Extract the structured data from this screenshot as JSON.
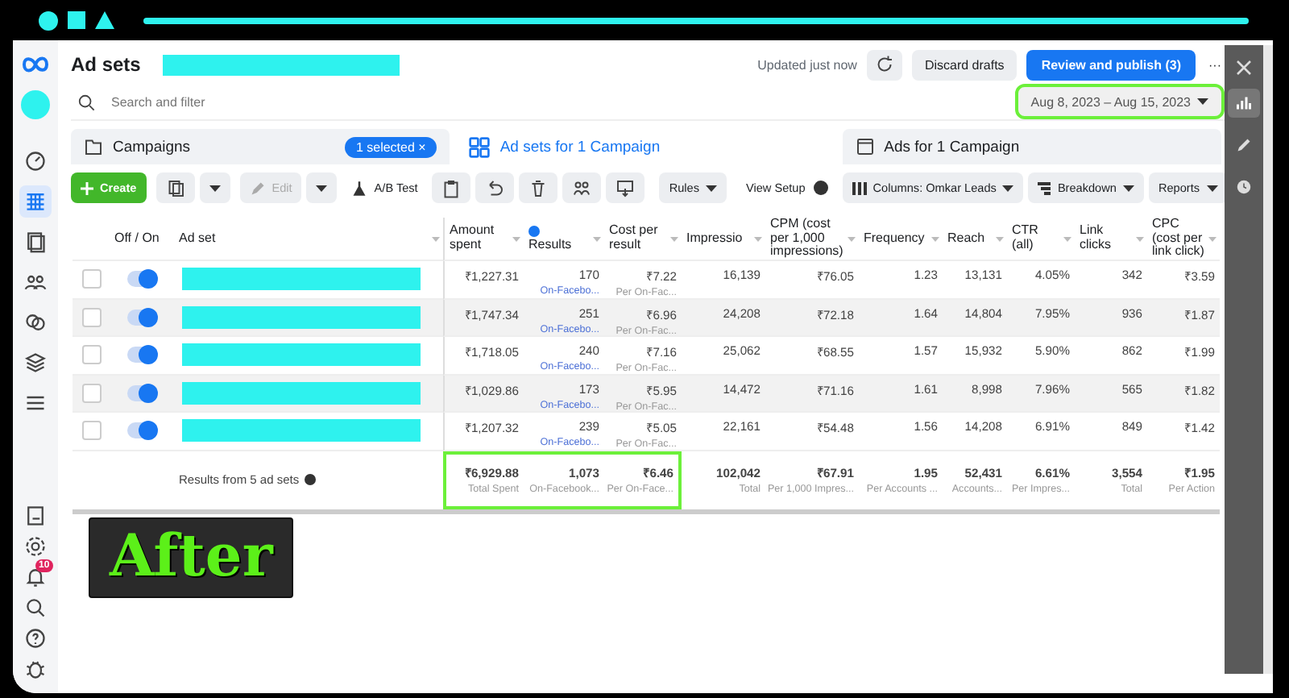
{
  "header": {
    "title": "Ad sets",
    "status": "Updated just now",
    "discard": "Discard drafts",
    "publish": "Review and publish (3)",
    "more": "···"
  },
  "search": {
    "placeholder": "Search and filter"
  },
  "date_range": {
    "value": "Aug 8, 2023 – Aug 15, 2023",
    "highlighted": true
  },
  "tabs": [
    {
      "label": "Campaigns",
      "selected": false,
      "badge": "1 selected",
      "badge_close": "×"
    },
    {
      "label": "Ad sets for 1 Campaign",
      "selected": true
    },
    {
      "label": "Ads for 1 Campaign",
      "selected": false
    }
  ],
  "toolbar": {
    "create": "Create",
    "edit": {
      "label": "Edit",
      "disabled": true
    },
    "ab_test": "A/B Test",
    "rules": "Rules",
    "view_setup": "View Setup",
    "columns": "Columns: Omkar Leads",
    "breakdown": "Breakdown",
    "reports": "Reports"
  },
  "table": {
    "toggle_column": "Off / On",
    "name_column": "Ad set",
    "columns": [
      "Amount spent",
      "Results",
      "Cost per result",
      "Impressio",
      "CPM (cost per 1,000 impressions)",
      "Frequency",
      "Reach",
      "CTR (all)",
      "Link clicks",
      "CPC (cost per link click)"
    ],
    "rows": [
      {
        "checked": false,
        "on": true,
        "cells": [
          "₹1,227.31",
          "170",
          "₹7.22",
          "16,139",
          "₹76.05",
          "1.23",
          "13,131",
          "4.05%",
          "342",
          "₹3.59"
        ],
        "results_sub": "On-Facebo...",
        "cost_sub": "Per On-Fac..."
      },
      {
        "checked": false,
        "on": true,
        "cells": [
          "₹1,747.34",
          "251",
          "₹6.96",
          "24,208",
          "₹72.18",
          "1.64",
          "14,804",
          "7.95%",
          "936",
          "₹1.87"
        ],
        "results_sub": "On-Facebo...",
        "cost_sub": "Per On-Fac..."
      },
      {
        "checked": false,
        "on": true,
        "cells": [
          "₹1,718.05",
          "240",
          "₹7.16",
          "25,062",
          "₹68.55",
          "1.57",
          "15,932",
          "5.90%",
          "862",
          "₹1.99"
        ],
        "results_sub": "On-Facebo...",
        "cost_sub": "Per On-Fac..."
      },
      {
        "checked": false,
        "on": true,
        "cells": [
          "₹1,029.86",
          "173",
          "₹5.95",
          "14,472",
          "₹71.16",
          "1.61",
          "8,998",
          "7.96%",
          "565",
          "₹1.82"
        ],
        "results_sub": "On-Facebo...",
        "cost_sub": "Per On-Fac..."
      },
      {
        "checked": false,
        "on": true,
        "cells": [
          "₹1,207.32",
          "239",
          "₹5.05",
          "22,161",
          "₹54.48",
          "1.56",
          "14,208",
          "6.91%",
          "849",
          "₹1.42"
        ],
        "results_sub": "On-Facebo...",
        "cost_sub": "Per On-Fac..."
      }
    ],
    "footer": {
      "label": "Results from 5 ad sets",
      "cells": [
        {
          "value": "₹6,929.88",
          "sub": "Total Spent",
          "highlighted": true
        },
        {
          "value": "1,073",
          "sub": "On-Facebook...",
          "highlighted": true
        },
        {
          "value": "₹6.46",
          "sub": "Per On-Face...",
          "highlighted": true
        },
        {
          "value": "102,042",
          "sub": "Total",
          "highlighted": false
        },
        {
          "value": "₹67.91",
          "sub": "Per 1,000 Impres...",
          "highlighted": false
        },
        {
          "value": "1.95",
          "sub": "Per Accounts ...",
          "highlighted": false
        },
        {
          "value": "52,431",
          "sub": "Accounts...",
          "highlighted": false
        },
        {
          "value": "6.61%",
          "sub": "Per Impres...",
          "highlighted": false
        },
        {
          "value": "3,554",
          "sub": "Total",
          "highlighted": false
        },
        {
          "value": "₹1.95",
          "sub": "Per Action",
          "highlighted": false
        }
      ]
    }
  },
  "nav": {
    "items": [
      {
        "selected": false
      },
      {
        "selected": true
      },
      {
        "selected": false
      },
      {
        "selected": false
      },
      {
        "selected": false
      },
      {
        "selected": false
      },
      {
        "selected": false
      }
    ],
    "notification_count": "10"
  },
  "right_panel": {
    "items": [
      {
        "selected": true
      },
      {
        "selected": false
      },
      {
        "selected": false
      }
    ]
  },
  "overlay_label": "After"
}
